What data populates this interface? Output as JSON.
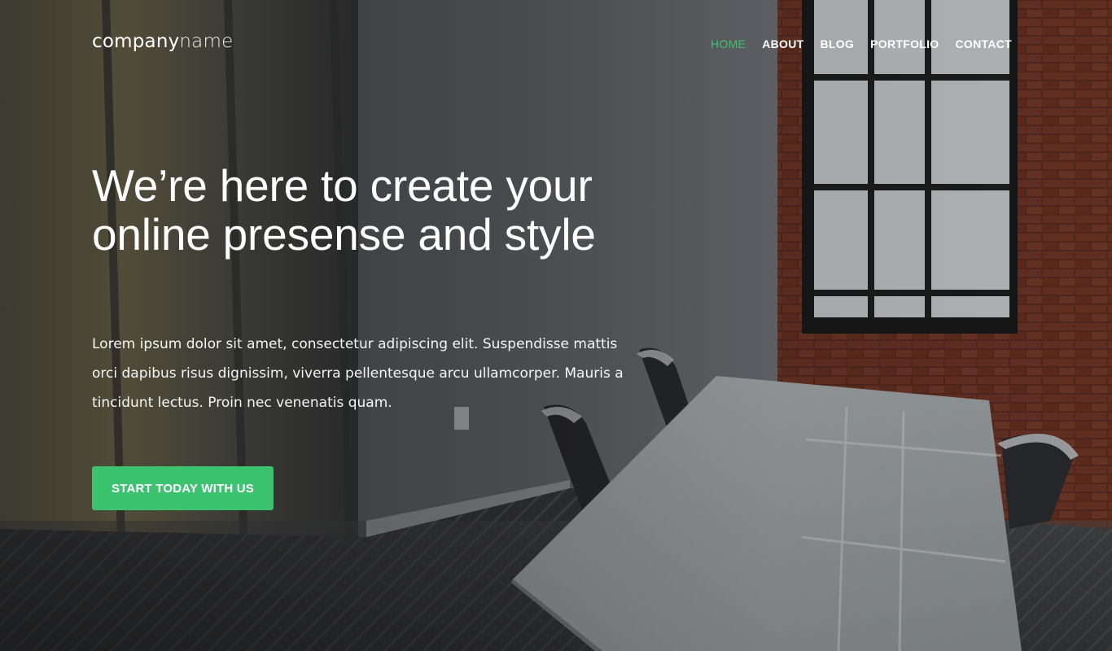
{
  "brand": {
    "logo_part1": "company",
    "logo_part2": "name"
  },
  "nav": {
    "items": [
      {
        "label": "HOME",
        "active": true
      },
      {
        "label": "ABOUT",
        "active": false
      },
      {
        "label": "BLOG",
        "active": false
      },
      {
        "label": "PORTFOLIO",
        "active": false
      },
      {
        "label": "CONTACT",
        "active": false
      }
    ]
  },
  "hero": {
    "headline": "We’re here to create your online presense and style",
    "lead": "Lorem ipsum dolor sit amet, consectetur adipiscing elit. Suspendisse mattis orci dapibus risus dignissim, viverra pellentesque arcu ullamcorper. Mauris a tincidunt lectus. Proin nec venenatis quam.",
    "cta_label": "START TODAY WITH US"
  },
  "colors": {
    "accent": "#3cc36f",
    "text": "#ffffff"
  }
}
